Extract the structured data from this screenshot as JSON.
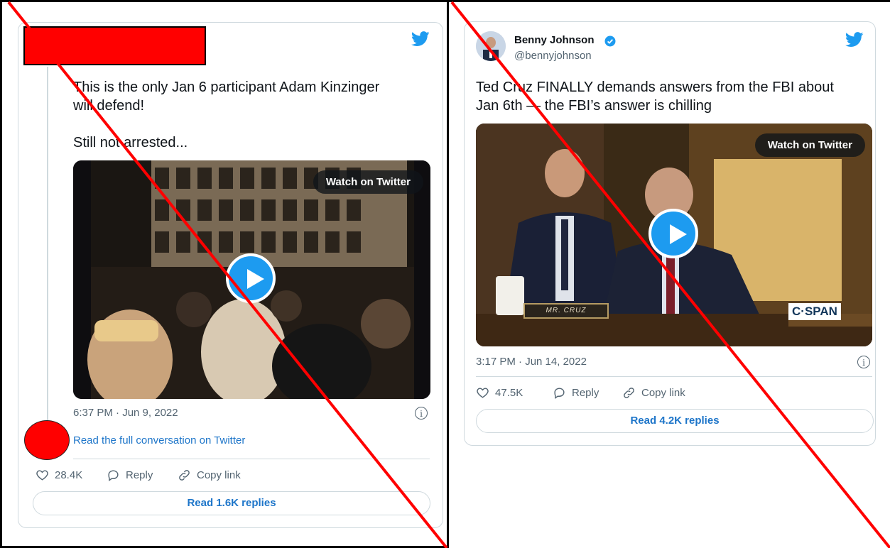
{
  "left_tweet": {
    "text": "This is the only Jan 6 participant Adam Kinzinger\nwill defend!\n\nStill not arrested...",
    "watch_label": "Watch on Twitter",
    "timestamp": "6:37 PM · Jun 9, 2022",
    "conversation_link": "Read the full conversation on Twitter",
    "likes": "28.4K",
    "reply_label": "Reply",
    "copy_link_label": "Copy link",
    "read_replies": "Read 1.6K replies"
  },
  "right_tweet": {
    "author_name": "Benny Johnson",
    "author_handle": "@bennyjohnson",
    "text": "Ted Cruz FINALLY demands answers from the FBI about\nJan 6th — the FBI’s answer is chilling",
    "watch_label": "Watch on Twitter",
    "nameplate": "MR. CRUZ",
    "broadcast_logo": "C·SPAN",
    "timestamp": "3:17 PM · Jun 14, 2022",
    "likes": "47.5K",
    "reply_label": "Reply",
    "copy_link_label": "Copy link",
    "read_replies": "Read 4.2K replies"
  },
  "colors": {
    "twitter_blue": "#1d9bf0",
    "link_blue": "#1d75c9",
    "redaction_red": "#ff0000",
    "slash_red": "#ff0000",
    "muted_text": "#536471"
  },
  "icons": [
    "twitter-bird-icon",
    "heart-icon",
    "reply-icon",
    "copy-link-icon",
    "info-icon",
    "verified-badge-icon",
    "play-icon"
  ]
}
